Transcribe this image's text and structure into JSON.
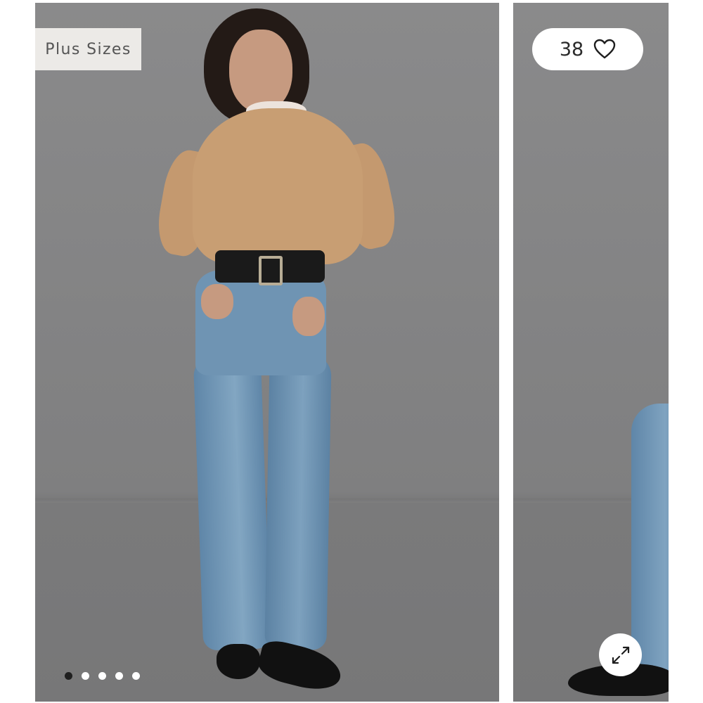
{
  "gallery": {
    "badge_label": "Plus Sizes",
    "favorite_count": "38",
    "favorite_icon": "heart-outline-icon",
    "expand_icon": "expand-arrows-icon",
    "slide_count": 5,
    "active_slide": 1,
    "slides": [
      {
        "image": "product-photo-model-front"
      },
      {
        "image": "product-photo-model-side"
      }
    ]
  },
  "colors": {
    "background": "#ffffff",
    "photo_backdrop": "#858586",
    "badge_bg": "#eceae7",
    "badge_text": "#555555",
    "dot_active": "#1f1f1f",
    "dot_inactive": "#ffffff"
  }
}
